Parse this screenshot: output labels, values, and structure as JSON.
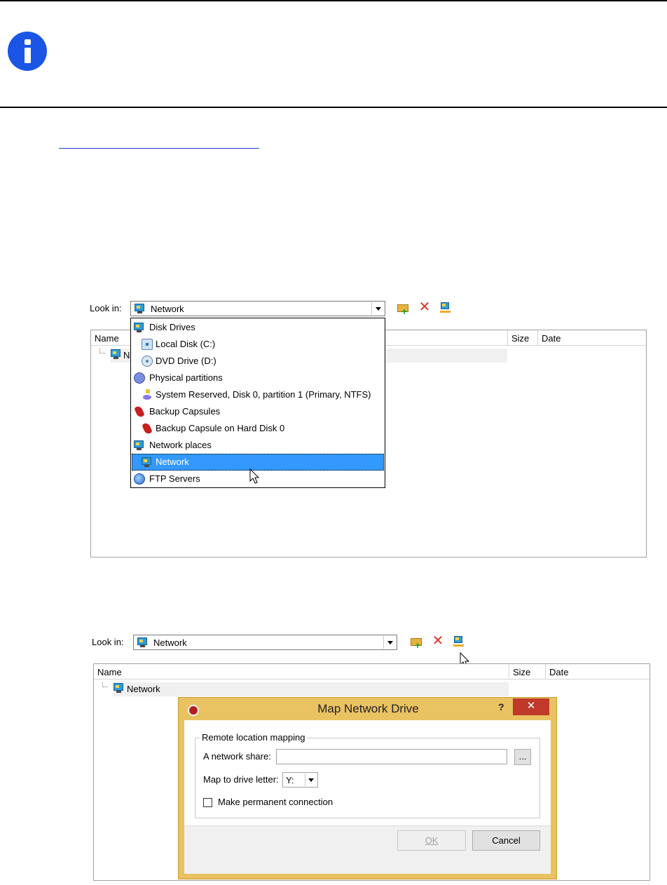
{
  "screenshot1": {
    "look_in_label": "Look in:",
    "look_in_value": "Network",
    "columns": [
      "Name",
      "Size",
      "Date"
    ],
    "tree_item_partial": "N",
    "dropdown_items": [
      {
        "label": "Disk Drives",
        "icon": "network-monitor-icon",
        "indent": 0,
        "selected": false
      },
      {
        "label": "Local Disk (C:)",
        "icon": "local-disk-icon",
        "indent": 1,
        "selected": false
      },
      {
        "label": "DVD Drive (D:)",
        "icon": "dvd-drive-icon",
        "indent": 1,
        "selected": false
      },
      {
        "label": "Physical partitions",
        "icon": "physical-partitions-icon",
        "indent": 0,
        "selected": false
      },
      {
        "label": "System Reserved, Disk 0, partition 1 (Primary, NTFS)",
        "icon": "system-reserved-partition-icon",
        "indent": 1,
        "selected": false
      },
      {
        "label": "Backup Capsules",
        "icon": "backup-capsule-icon",
        "indent": 0,
        "selected": false
      },
      {
        "label": "Backup Capsule on Hard Disk 0",
        "icon": "backup-capsule-icon",
        "indent": 1,
        "selected": false
      },
      {
        "label": "Network places",
        "icon": "network-monitor-icon",
        "indent": 0,
        "selected": false
      },
      {
        "label": "Network",
        "icon": "network-monitor-icon",
        "indent": 1,
        "selected": true
      },
      {
        "label": "FTP Servers",
        "icon": "ftp-globe-icon",
        "indent": 0,
        "selected": false
      }
    ]
  },
  "screenshot2": {
    "look_in_label": "Look in:",
    "look_in_value": "Network",
    "columns": [
      "Name",
      "Size",
      "Date"
    ],
    "tree_item": "Network"
  },
  "dialog": {
    "title": "Map Network Drive",
    "help": "?",
    "close": "✕",
    "group_title": "Remote location mapping",
    "network_share_label": "A network share:",
    "network_share_value": "",
    "browse_label": "...",
    "drive_letter_label": "Map to drive letter:",
    "drive_letter_value": "Y:",
    "permanent_label": "Make permanent connection",
    "permanent_checked": false,
    "ok_label": "OK",
    "cancel_label": "Cancel"
  },
  "colors": {
    "info_icon": "#1a55e6",
    "selection": "#3399ff",
    "dialog_frame": "#e9c262",
    "close_button": "#c0392b"
  }
}
